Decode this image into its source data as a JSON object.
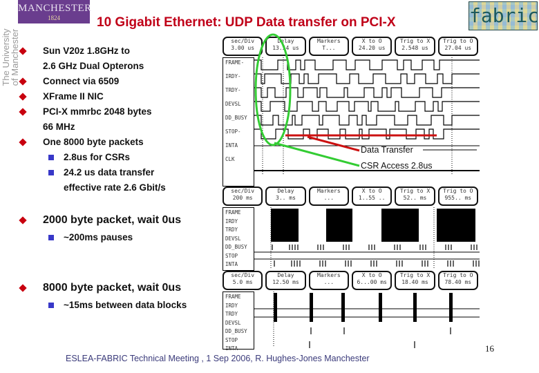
{
  "header": {
    "logo_name": "MANCHESTER",
    "logo_year": "1824",
    "university_line1": "The University",
    "university_line2": "of Manchester",
    "title": "10 Gigabit Ethernet: UDP Data transfer on PCI-X",
    "partner_logo": "fabric"
  },
  "colors": {
    "title": "#c00018",
    "bullet_diamond": "#c8000f",
    "bullet_square": "#3838c8",
    "logo_bg": "#6a3d8e",
    "footer_text": "#3a3a7a",
    "csr_ellipse": "#33cc33",
    "data_line": "#cc1111"
  },
  "bullets": [
    {
      "icon": "diamond-bullet",
      "lines": [
        "Sun V20z 1.8GHz to",
        "2.6 GHz Dual Opterons"
      ]
    },
    {
      "icon": "diamond-bullet",
      "lines": [
        "Connect via 6509"
      ]
    },
    {
      "icon": "diamond-bullet",
      "lines": [
        "XFrame II NIC"
      ]
    },
    {
      "icon": "diamond-bullet",
      "lines": [
        "PCI-X mmrbc 2048 bytes",
        "66 MHz"
      ]
    },
    {
      "icon": "diamond-bullet",
      "lines": [
        "One 8000 byte packets"
      ]
    }
  ],
  "sub_bullets": [
    {
      "icon": "square-bullet",
      "lines": [
        "2.8us for CSRs"
      ]
    },
    {
      "icon": "square-bullet",
      "lines": [
        "24.2 us data transfer",
        "effective rate 2.6 Gbit/s"
      ]
    }
  ],
  "section2": {
    "heading": "2000 byte packet, wait 0us",
    "sub": "~200ms pauses"
  },
  "section3": {
    "heading": "8000 byte packet, wait 0us",
    "sub": "~15ms between data blocks"
  },
  "scope1": {
    "readouts": [
      {
        "label": "sec/Div",
        "value": "3.00 us"
      },
      {
        "label": "Delay",
        "value": "13.54 us"
      },
      {
        "label": "Markers",
        "value": "T..."
      },
      {
        "label": "X to O",
        "value": "24.20 us"
      },
      {
        "label": "Trig to X",
        "value": "2.548 us"
      },
      {
        "label": "Trig to O",
        "value": "27.04 us"
      }
    ],
    "signals": [
      "FRAME-",
      "IRDY-",
      "TRDY-",
      "DEVSL",
      "DD_BUSY",
      "STOP-",
      "INTA",
      "CLK"
    ],
    "annotations": {
      "data_transfer": "Data Transfer",
      "csr_access": "CSR Access 2.8us"
    }
  },
  "scope2": {
    "readouts": [
      {
        "label": "sec/Div",
        "value": "200 ms"
      },
      {
        "label": "Delay",
        "value": "3.. ms"
      },
      {
        "label": "Markers",
        "value": "..."
      },
      {
        "label": "X to O",
        "value": "1..55 .."
      },
      {
        "label": "Trig to X",
        "value": "52.. ms"
      },
      {
        "label": "Trig to O",
        "value": "955.. ms"
      }
    ],
    "signals": [
      "FRAME",
      "IRDY",
      "TRDY",
      "DEVSL",
      "DD_BUSY",
      "STOP",
      "INTA"
    ]
  },
  "scope3": {
    "readouts": [
      {
        "label": "sec/Div",
        "value": "5.0 ms"
      },
      {
        "label": "Delay",
        "value": "12.50 ms"
      },
      {
        "label": "Markers",
        "value": "..."
      },
      {
        "label": "X to O",
        "value": "6...00 ms"
      },
      {
        "label": "Trig to X",
        "value": "18.40 ms"
      },
      {
        "label": "Trig to O",
        "value": "78.40 ms"
      }
    ],
    "signals": [
      "FRAME",
      "IRDY",
      "TRDY",
      "DEVSL",
      "DD_BUSY",
      "STOP",
      "INTA"
    ]
  },
  "footer": {
    "text": "ESLEA-FABRIC Technical Meeting , 1 Sep 2006,  R. Hughes-Jones  Manchester",
    "page_number": "16"
  }
}
